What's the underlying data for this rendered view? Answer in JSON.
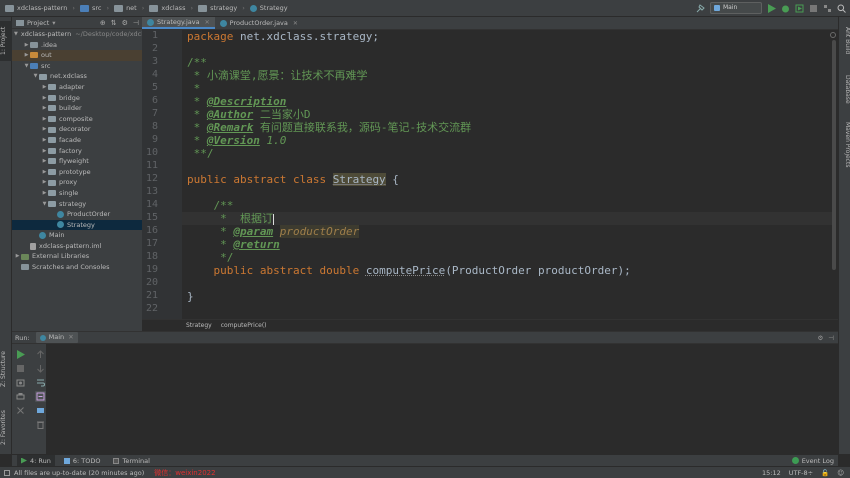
{
  "nav": {
    "crumbs": [
      "xdclass-pattern",
      "src",
      "net",
      "xdclass",
      "strategy",
      "Strategy"
    ],
    "run_config": "Main"
  },
  "left_strip": {
    "project": "1: Project",
    "structure": "Z: Structure",
    "favorites": "2: Favorites"
  },
  "right_strip": {
    "ant": "Ant Build",
    "database": "Database",
    "maven": "Maven Projects"
  },
  "project_panel": {
    "title": "Project",
    "tree": [
      {
        "label": "xdclass-pattern",
        "hint": "~/Desktop/code/xdclass",
        "depth": 0,
        "arrow": "▼",
        "icon": "ic-folder"
      },
      {
        "label": ".idea",
        "depth": 1,
        "arrow": "▶",
        "icon": "ic-folder"
      },
      {
        "label": "out",
        "depth": 1,
        "arrow": "▶",
        "icon": "ic-orange",
        "state": "out"
      },
      {
        "label": "src",
        "depth": 1,
        "arrow": "▼",
        "icon": "ic-src"
      },
      {
        "label": "net.xdclass",
        "depth": 2,
        "arrow": "▼",
        "icon": "ic-pkg"
      },
      {
        "label": "adapter",
        "depth": 3,
        "arrow": "▶",
        "icon": "ic-pkg"
      },
      {
        "label": "bridge",
        "depth": 3,
        "arrow": "▶",
        "icon": "ic-pkg"
      },
      {
        "label": "builder",
        "depth": 3,
        "arrow": "▶",
        "icon": "ic-pkg"
      },
      {
        "label": "composite",
        "depth": 3,
        "arrow": "▶",
        "icon": "ic-pkg"
      },
      {
        "label": "decorator",
        "depth": 3,
        "arrow": "▶",
        "icon": "ic-pkg"
      },
      {
        "label": "facade",
        "depth": 3,
        "arrow": "▶",
        "icon": "ic-pkg"
      },
      {
        "label": "factory",
        "depth": 3,
        "arrow": "▶",
        "icon": "ic-pkg"
      },
      {
        "label": "flyweight",
        "depth": 3,
        "arrow": "▶",
        "icon": "ic-pkg"
      },
      {
        "label": "prototype",
        "depth": 3,
        "arrow": "▶",
        "icon": "ic-pkg"
      },
      {
        "label": "proxy",
        "depth": 3,
        "arrow": "▶",
        "icon": "ic-pkg"
      },
      {
        "label": "single",
        "depth": 3,
        "arrow": "▶",
        "icon": "ic-pkg"
      },
      {
        "label": "strategy",
        "depth": 3,
        "arrow": "▼",
        "icon": "ic-pkg"
      },
      {
        "label": "ProductOrder",
        "depth": 4,
        "arrow": "",
        "icon": "ic-class"
      },
      {
        "label": "Strategy",
        "depth": 4,
        "arrow": "",
        "icon": "ic-class",
        "state": "sel"
      },
      {
        "label": "Main",
        "depth": 2,
        "arrow": "",
        "icon": "ic-class"
      },
      {
        "label": "xdclass-pattern.iml",
        "depth": 1,
        "arrow": "",
        "icon": "ic-file"
      },
      {
        "label": "External Libraries",
        "depth": 0,
        "arrow": "▶",
        "icon": "ic-lib"
      },
      {
        "label": "Scratches and Consoles",
        "depth": 0,
        "arrow": "",
        "icon": "ic-folder"
      }
    ]
  },
  "editor": {
    "tabs": [
      {
        "label": "Strategy.java",
        "active": true
      },
      {
        "label": "ProductOrder.java",
        "active": false
      }
    ],
    "line_numbers": [
      "1",
      "2",
      "3",
      "4",
      "5",
      "6",
      "7",
      "8",
      "9",
      "10",
      "11",
      "12",
      "13",
      "14",
      "15",
      "16",
      "17",
      "18",
      "19",
      "20",
      "21",
      "22"
    ],
    "code": {
      "l1_kw": "package",
      "l1_rest": " net.xdclass.strategy;",
      "l3": "/**",
      "l4": " * 小滴课堂,愿景：让技术不再难学",
      "l5": " *",
      "l6_pre": " * ",
      "l6_tag": "@Description",
      "l7_pre": " * ",
      "l7_tag": "@Author",
      "l7_val": " 二当家小D",
      "l8_pre": " * ",
      "l8_tag": "@Remark",
      "l8_val": " 有问题直接联系我，源码-笔记-技术交流群",
      "l9_pre": " * ",
      "l9_tag": "@Version",
      "l9_val": " 1.0",
      "l10": " **/",
      "l12_kw": "public abstract class",
      "l12_sp": " ",
      "l12_cls": "Strategy",
      "l12_rest": " {",
      "l14": "    /**",
      "l15": "     *  根据订",
      "l16_pre": "     * ",
      "l16_tag": "@param",
      "l16_sp": " ",
      "l16_param": "productOrder",
      "l17_pre": "     * ",
      "l17_tag": "@return",
      "l18": "     */",
      "l19_ind": "    ",
      "l19_kw": "public abstract double",
      "l19_sp": " ",
      "l19_method": "computePrice",
      "l19_rest": "(ProductOrder productOrder);",
      "l21": "}"
    },
    "breadcrumb": [
      "Strategy",
      "computePrice()"
    ]
  },
  "run_panel": {
    "label": "Run:",
    "tab": "Main"
  },
  "bottom_tabs": [
    {
      "label": "4: Run",
      "active": true
    },
    {
      "label": "6: TODO",
      "active": false
    },
    {
      "label": "Terminal",
      "active": false
    }
  ],
  "event_log": "Event Log",
  "status": {
    "message": "All files are up-to-date (20 minutes ago)",
    "watermark": "微信：weixin2022",
    "position": "15:12",
    "encoding": "UTF-8÷"
  }
}
